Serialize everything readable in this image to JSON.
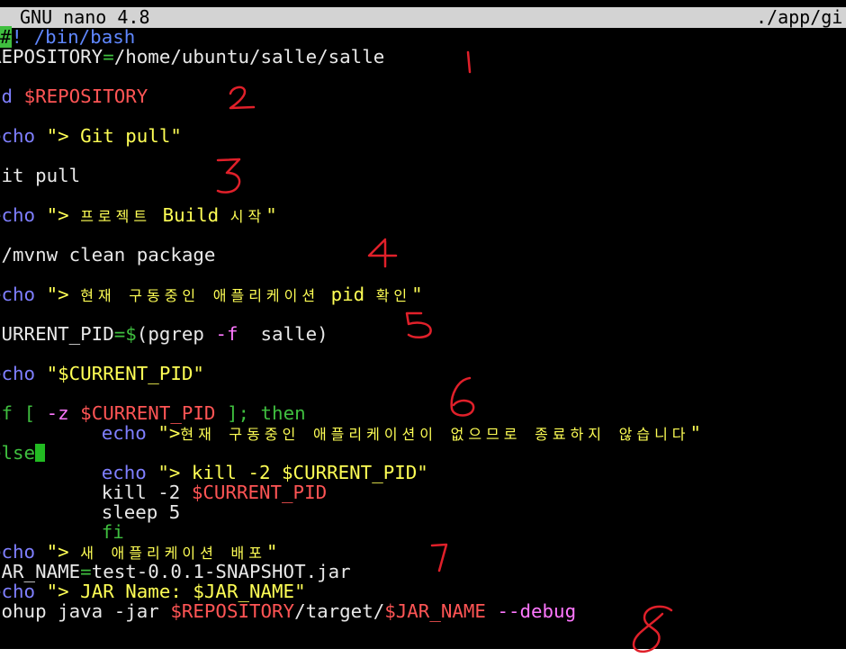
{
  "titlebar": {
    "app": "GNU nano 4.8",
    "file": "./app/gi"
  },
  "script": {
    "shebang_hash": "#",
    "shebang_rest": "! /bin/bash",
    "repo_var": "REPOSITORY",
    "repo_eq": "=",
    "repo_path": "/home/ubuntu/salle/salle",
    "cd_kw": "cd",
    "cd_arg": "$REPOSITORY",
    "echo": "echo",
    "echo_git": "\"> Git pull\"",
    "git_pull": "git pull",
    "echo_build_a": " \"> ",
    "echo_build_kr1": "프로젝트",
    "echo_build_mid": " Build ",
    "echo_build_kr2": "시작",
    "echo_build_end": "\"",
    "mvnw": "./mvnw clean package",
    "echo_pid_a": "\"> ",
    "echo_pid_kr1": "현재 구동중인 애플리케이션",
    "echo_pid_mid": " pid ",
    "echo_pid_kr2": "확인",
    "echo_pid_end": "\"",
    "cur_var": "CURRENT_PID",
    "cur_eq": "=",
    "cur_dollar": "$",
    "cur_open": "(pgrep ",
    "cur_flag": "-f",
    "cur_rest": "  salle",
    "cur_close": ")",
    "echo_cur": "\"$CURRENT_PID\"",
    "if_kw": "if",
    "if_open": " [ ",
    "if_flag": "-z",
    "if_var": " $CURRENT_PID",
    "if_close": " ]; ",
    "then_kw": "then",
    "indent": "         ",
    "echo_none_a": "\">",
    "echo_none_kr": "현재 구동중인 애플리케이션이 없으므로 종료하지 않습니다",
    "echo_none_end": "\"",
    "else_kw": "else",
    "echo_kill": "\"> kill -2 $CURRENT_PID\"",
    "kill_cmd": "kill -2 ",
    "kill_var": "$CURRENT_PID",
    "sleep_cmd": "sleep 5",
    "fi_kw": "fi",
    "echo_deploy_a": "\"> ",
    "echo_deploy_kr": "새 애플리케이션 배포",
    "echo_deploy_end": "\"",
    "jar_var": "JAR_NAME",
    "jar_eq": "=",
    "jar_val": "test-0.0.1-SNAPSHOT.jar",
    "echo_jar": "\"> JAR Name: $JAR_NAME\"",
    "nohup_cmd": "nohup java -jar ",
    "nohup_repo": "$REPOSITORY",
    "nohup_path": "/target/",
    "nohup_jar": "$JAR_NAME",
    "nohup_flag": " --debug"
  },
  "annotations": [
    "1",
    "2",
    "3",
    "4",
    "5",
    "6",
    "7",
    "8"
  ],
  "colors": {
    "background": "#000000",
    "titlebar": "#d3d3d3",
    "keyword": "#7f7fff",
    "string": "#ffff55",
    "variable": "#ff5555",
    "comment_green": "#3fbf3f",
    "annotation_red": "#e0202a"
  }
}
